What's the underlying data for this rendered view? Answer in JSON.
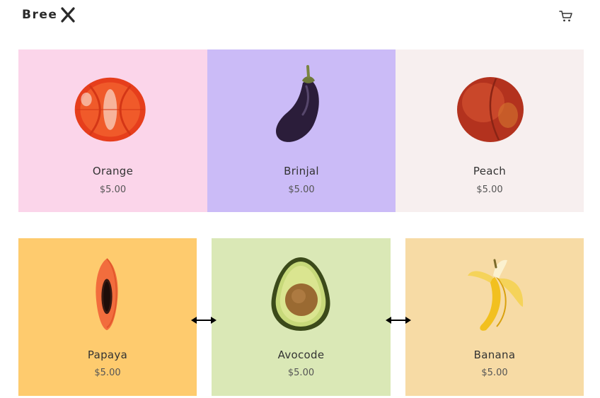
{
  "brand": {
    "name": "Bree",
    "logo_icon": "x-mark-icon"
  },
  "header": {
    "cart_icon": "cart-icon"
  },
  "products": [
    {
      "name": "Orange",
      "price": "$5.00",
      "bg": "#fbd5ea"
    },
    {
      "name": "Brinjal",
      "price": "$5.00",
      "bg": "#cbbbf7"
    },
    {
      "name": "Peach",
      "price": "$5.00",
      "bg": "#f7efef"
    },
    {
      "name": "Papaya",
      "price": "$5.00",
      "bg": "#fecb6e"
    },
    {
      "name": "Avocode",
      "price": "$5.00",
      "bg": "#dae8b6"
    },
    {
      "name": "Banana",
      "price": "$5.00",
      "bg": "#f7dba5"
    }
  ],
  "resize_handles": [
    {
      "icon": "double-arrow-horizontal-icon"
    },
    {
      "icon": "double-arrow-horizontal-icon"
    }
  ]
}
